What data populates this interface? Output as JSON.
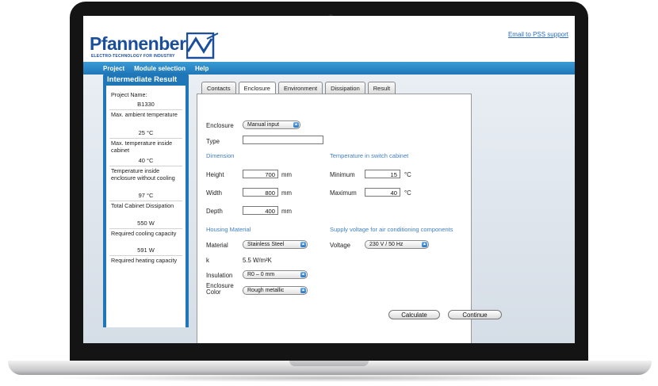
{
  "app": {
    "brand_name": "Pfannenberg",
    "brand_tagline": "ELECTRO-TECHNOLOGY FOR INDUSTRY",
    "support_link": "Email to PSS support"
  },
  "menu": [
    "Project",
    "Module selection",
    "Help"
  ],
  "sidebar": {
    "title": "Intermediate Result",
    "project_name_label": "Project Name:",
    "project_name_value": "B1330",
    "items": [
      {
        "label": "Max. ambient temperature",
        "value": "25 °C"
      },
      {
        "label": "Max. temperature inside cabinet",
        "value": "40 °C"
      },
      {
        "label": "Temperature inside enclosure without cooling",
        "value": "97 °C"
      },
      {
        "label": "Total Cabinet Dissipation",
        "value": "550 W"
      },
      {
        "label": "Required cooling capacity",
        "value": "591 W"
      },
      {
        "label": "Required heating capacity",
        "value": ""
      }
    ]
  },
  "tabs": [
    "Contacts",
    "Enclosure",
    "Environment",
    "Dissipation",
    "Result"
  ],
  "active_tab": "Enclosure",
  "form": {
    "enclosure_label": "Enclosure",
    "enclosure_value": "Manual input",
    "type_label": "Type",
    "type_value": "",
    "dimension_heading": "Dimension",
    "height_label": "Height",
    "height_value": "700",
    "width_label": "Width",
    "width_value": "800",
    "depth_label": "Depth",
    "depth_value": "400",
    "length_unit": "mm",
    "temp_heading": "Temperature in switch cabinet",
    "minimum_label": "Minimum",
    "minimum_value": "15",
    "maximum_label": "Maximum",
    "maximum_value": "40",
    "temp_unit": "°C",
    "housing_heading": "Housing Material",
    "material_label": "Material",
    "material_value": "Stainless Steel",
    "k_label": "k",
    "k_value": "5.5 W/m²K",
    "insulation_label": "Insulation",
    "insulation_value": "R0 – 0 mm",
    "color_label": "Enclosure Color",
    "color_value": "Rough metallic",
    "supply_heading": "Supply voltage for air conditioning components",
    "voltage_label": "Voltage",
    "voltage_value": "230 V / 50 Hz"
  },
  "buttons": {
    "calculate": "Calculate",
    "continue": "Continue"
  },
  "colors": {
    "brand_blue": "#1b4f9c",
    "menubar": "#1f77b8",
    "section_heading": "#3f80c4"
  },
  "icons": [
    "select-arrows-icon"
  ]
}
